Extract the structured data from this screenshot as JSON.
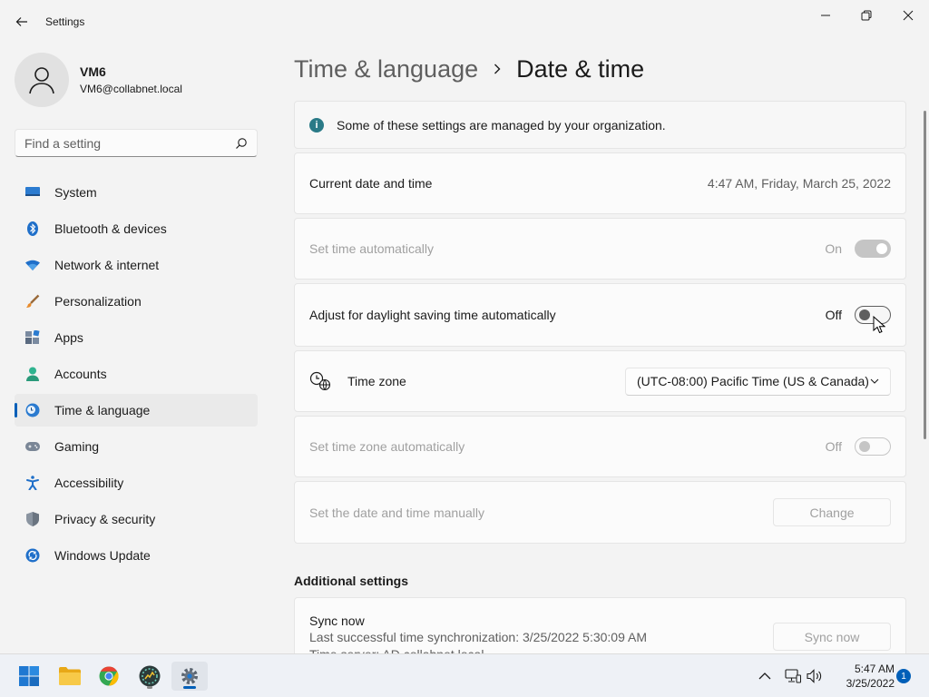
{
  "app": {
    "title": "Settings"
  },
  "profile": {
    "name": "VM6",
    "email": "VM6@collabnet.local"
  },
  "search": {
    "placeholder": "Find a setting"
  },
  "sidebar": {
    "items": [
      {
        "label": "System",
        "icon": "monitor-icon",
        "active": false
      },
      {
        "label": "Bluetooth & devices",
        "icon": "bluetooth-icon",
        "active": false
      },
      {
        "label": "Network & internet",
        "icon": "wifi-icon",
        "active": false
      },
      {
        "label": "Personalization",
        "icon": "brush-icon",
        "active": false
      },
      {
        "label": "Apps",
        "icon": "apps-icon",
        "active": false
      },
      {
        "label": "Accounts",
        "icon": "person-icon",
        "active": false
      },
      {
        "label": "Time & language",
        "icon": "clock-globe-icon",
        "active": true
      },
      {
        "label": "Gaming",
        "icon": "gamepad-icon",
        "active": false
      },
      {
        "label": "Accessibility",
        "icon": "accessibility-icon",
        "active": false
      },
      {
        "label": "Privacy & security",
        "icon": "shield-icon",
        "active": false
      },
      {
        "label": "Windows Update",
        "icon": "update-icon",
        "active": false
      }
    ]
  },
  "breadcrumb": {
    "parent": "Time & language",
    "current": "Date & time"
  },
  "main": {
    "info_banner": "Some of these settings are managed by your organization.",
    "current_datetime": {
      "label": "Current date and time",
      "value": "4:47 AM, Friday, March 25, 2022"
    },
    "set_time_auto": {
      "label": "Set time automatically",
      "state": "On",
      "enabled": false
    },
    "daylight_saving": {
      "label": "Adjust for daylight saving time automatically",
      "state": "Off",
      "enabled": true
    },
    "time_zone": {
      "label": "Time zone",
      "value": "(UTC-08:00) Pacific Time (US & Canada)"
    },
    "set_tz_auto": {
      "label": "Set time zone automatically",
      "state": "Off",
      "enabled": false
    },
    "manual": {
      "label": "Set the date and time manually",
      "button": "Change",
      "enabled": false
    },
    "additional_title": "Additional settings",
    "sync": {
      "title": "Sync now",
      "last_sync": "Last successful time synchronization: 3/25/2022 5:30:09 AM",
      "server": "Time server: AD.collabnet.local",
      "button": "Sync now"
    }
  },
  "taskbar": {
    "apps": [
      "start-icon",
      "file-explorer-icon",
      "chrome-icon",
      "app-icon",
      "settings-icon"
    ],
    "time": "5:47 AM",
    "date": "3/25/2022",
    "notifications": "1"
  },
  "colors": {
    "accent": "#005fb8",
    "info": "#2a7a87"
  }
}
